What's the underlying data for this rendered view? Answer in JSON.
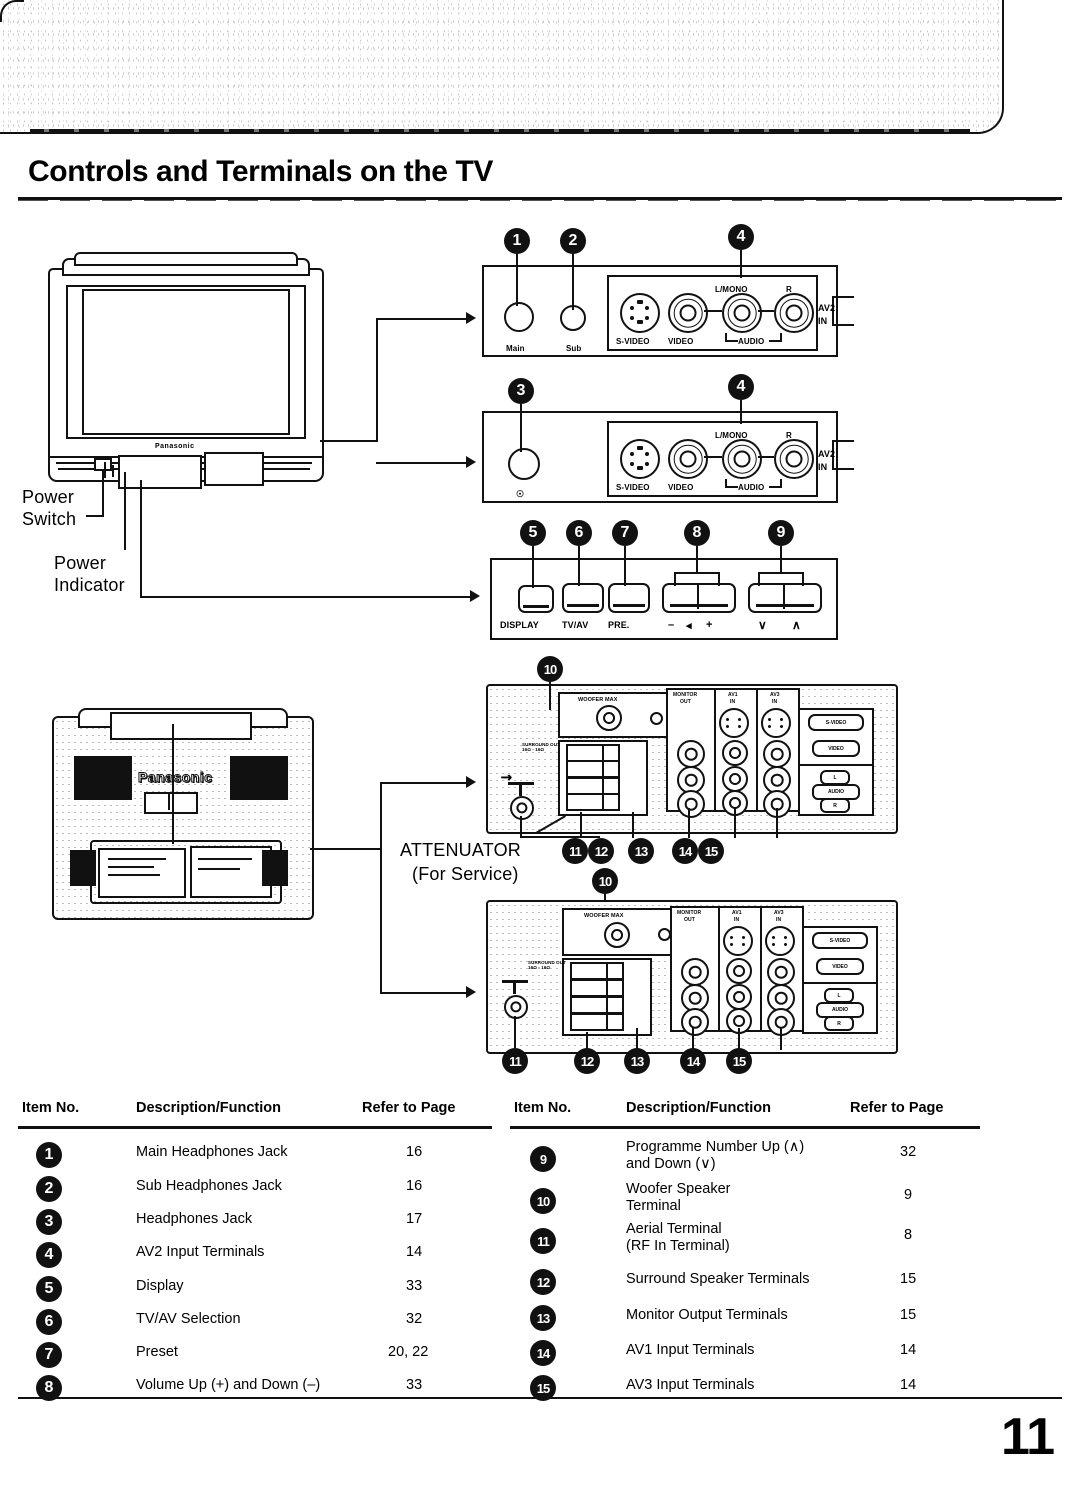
{
  "page": {
    "title": "Controls and Terminals on the TV",
    "number": "11",
    "brand": "Panasonic"
  },
  "annotations": {
    "power_switch": "Power\nSwitch",
    "power_switch_line1": "Power",
    "power_switch_line2": "Switch",
    "power_indicator_line1": "Power",
    "power_indicator_line2": "Indicator",
    "attenuator_line1": "ATTENUATOR",
    "attenuator_line2": "(For Service)"
  },
  "panel_top": {
    "callouts": [
      "1",
      "2",
      "4"
    ],
    "jack_labels": [
      "Main",
      "Sub"
    ],
    "terminal_labels": {
      "s_video": "S-VIDEO",
      "video": "VIDEO",
      "audio": "AUDIO",
      "l_mono": "L/MONO",
      "r": "R",
      "input_line1": "AV2",
      "input_line2": "IN"
    }
  },
  "panel_second": {
    "callouts": [
      "3",
      "4"
    ],
    "terminal_labels": {
      "s_video": "S-VIDEO",
      "video": "VIDEO",
      "audio": "AUDIO",
      "l_mono": "L/MONO",
      "r": "R",
      "input_line1": "AV2",
      "input_line2": "IN"
    }
  },
  "panel_buttons": {
    "callouts": [
      "5",
      "6",
      "7",
      "8",
      "9"
    ],
    "labels": {
      "display": "DISPLAY",
      "tv_av": "TV/AV",
      "preset": "PRE.",
      "vol_minus": "–",
      "vol_icon": "◂",
      "vol_plus": "+",
      "prog_down": "∨",
      "prog_up": "∧"
    }
  },
  "panel_rear": {
    "callouts_upper": [
      "10",
      "11",
      "12",
      "13",
      "14",
      "15"
    ],
    "callouts_lower": [
      "10",
      "11",
      "12",
      "13",
      "14",
      "15"
    ],
    "labels": {
      "woofer": "WOOFER MAX",
      "surround": "SURROUND OUT\n16Ω - 16Ω",
      "monitor_out_l1": "MONITOR",
      "monitor_out_l2": "OUT",
      "av1_l1": "AV1",
      "av1_l2": "IN",
      "av3_l1": "AV3",
      "av3_l2": "IN",
      "s_video": "S-VIDEO",
      "video": "VIDEO",
      "audio_l": "L",
      "audio": "AUDIO",
      "audio_r": "R"
    }
  },
  "tables": [
    {
      "headers": {
        "item": "Item No.",
        "description": "Description/Function",
        "page": "Refer to Page"
      },
      "rows": [
        {
          "num": "1",
          "desc": "Main Headphones Jack",
          "page": "16"
        },
        {
          "num": "2",
          "desc": "Sub Headphones Jack",
          "page": "16"
        },
        {
          "num": "3",
          "desc": "Headphones Jack",
          "page": "17"
        },
        {
          "num": "4",
          "desc": "AV2 Input Terminals",
          "page": "14"
        },
        {
          "num": "5",
          "desc": "Display",
          "page": "33"
        },
        {
          "num": "6",
          "desc": "TV/AV Selection",
          "page": "32"
        },
        {
          "num": "7",
          "desc": "Preset",
          "page": "20, 22"
        },
        {
          "num": "8",
          "desc": "Volume Up (+) and Down (–)",
          "page": "33"
        }
      ]
    },
    {
      "headers": {
        "item": "Item No.",
        "description": "Description/Function",
        "page": "Refer to Page"
      },
      "rows": [
        {
          "num": "9",
          "desc": "Programme Number Up (∧)\nand Down (∨)",
          "page": "32"
        },
        {
          "num": "10",
          "desc": "Woofer Speaker\nTerminal",
          "page": "9"
        },
        {
          "num": "11",
          "desc": "Aerial Terminal\n(RF In Terminal)",
          "page": "8"
        },
        {
          "num": "12",
          "desc": "Surround Speaker Terminals",
          "page": "15"
        },
        {
          "num": "13",
          "desc": "Monitor Output Terminals",
          "page": "15"
        },
        {
          "num": "14",
          "desc": "AV1 Input Terminals",
          "page": "14"
        },
        {
          "num": "15",
          "desc": "AV3 Input Terminals",
          "page": "14"
        }
      ]
    }
  ]
}
